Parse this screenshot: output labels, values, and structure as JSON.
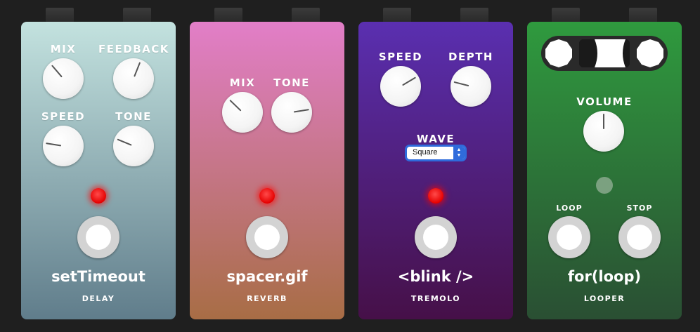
{
  "pedals": [
    {
      "name": "setTimeout",
      "type": "DELAY",
      "knobs": [
        {
          "label": "MIX",
          "level": 0.35
        },
        {
          "label": "FEEDBACK",
          "level": 0.58
        },
        {
          "label": "SPEED",
          "level": 0.2
        },
        {
          "label": "TONE",
          "level": 0.25
        }
      ],
      "led_on": true,
      "color_top": "#c3e2df",
      "color_bottom": "#607d8b"
    },
    {
      "name": "spacer.gif",
      "type": "REVERB",
      "knobs": [
        {
          "label": "MIX",
          "level": 0.33
        },
        {
          "label": "TONE",
          "level": 0.8
        }
      ],
      "led_on": true,
      "color_top": "#e27ec8",
      "color_bottom": "#a86d45"
    },
    {
      "name": "<blink />",
      "type": "TREMOLO",
      "knobs": [
        {
          "label": "SPEED",
          "level": 0.72
        },
        {
          "label": "DEPTH",
          "level": 0.22
        }
      ],
      "wave": {
        "label": "WAVE",
        "selected": "Square"
      },
      "led_on": true,
      "color_top": "#5a2fb0",
      "color_bottom": "#461048"
    },
    {
      "name": "for(loop)",
      "type": "LOOPER",
      "knobs": [
        {
          "label": "VOLUME",
          "level": 0.5
        }
      ],
      "buttons": {
        "loop_label": "LOOP",
        "stop_label": "STOP"
      },
      "led_on": false,
      "color_top": "#2f9a3e",
      "color_bottom": "#2a4f33"
    }
  ]
}
